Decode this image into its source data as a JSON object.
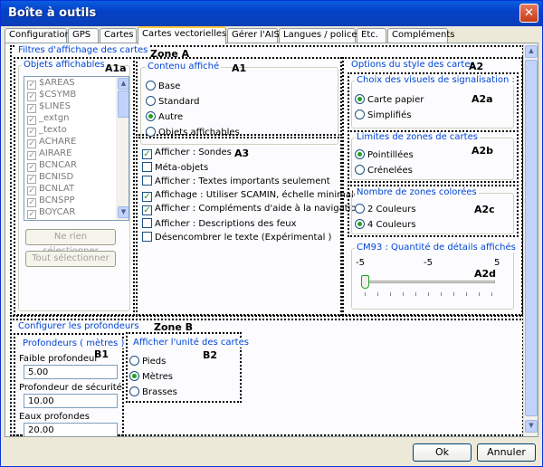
{
  "window": {
    "title": "Boîte à outils",
    "close": "✕"
  },
  "tabs": [
    "Configuration",
    "GPS",
    "Cartes",
    "Cartes vectorielles",
    "Gérer l'AIS",
    "Langues / polices",
    "Etc.",
    "Compléments"
  ],
  "active_tab": "Cartes vectorielles",
  "zone_a": {
    "legend": "Filtres d'affichage des cartes",
    "label": "Zone A",
    "objets": {
      "legend": "Objets affichables",
      "label": "A1a",
      "items": [
        "$AREAS",
        "$CSYMB",
        "$LINES",
        "_extgn",
        "_texto",
        "ACHARE",
        "AIRARE",
        "BCNCAR",
        "BCNISD",
        "BCNLAT",
        "BCNSPP",
        "BOYCAR"
      ],
      "btn_none": "Ne rien sélectionner",
      "btn_all": "Tout sélectionner"
    },
    "contenu": {
      "legend": "Contenu affiché",
      "label": "A1",
      "options": [
        "Base",
        "Standard",
        "Autre",
        "Objets affichables"
      ],
      "selected": "Autre"
    },
    "a3_label": "A3",
    "checks": [
      {
        "label": "Afficher : Sondes",
        "checked": true
      },
      {
        "label": "Méta-objets",
        "checked": false
      },
      {
        "label": "Afficher : Textes importants seulement",
        "checked": false
      },
      {
        "label": "Affichage : Utiliser SCAMIN, échelle minimale",
        "checked": true
      },
      {
        "label": "Afficher : Compléments d'aide à la navigation.",
        "checked": true
      },
      {
        "label": "Afficher : Descriptions des feux",
        "checked": false
      },
      {
        "label": "Désencombrer le texte (Expérimental )",
        "checked": false
      }
    ],
    "style": {
      "legend": "Options du style des cartes",
      "label": "A2",
      "visuels": {
        "legend": "Choix des visuels de signalisation :",
        "label": "A2a",
        "options": [
          "Carte papier",
          "Simplifiés"
        ],
        "selected": "Carte papier"
      },
      "limites": {
        "legend": "Limites de zones de cartes",
        "label": "A2b",
        "options": [
          "Pointillées",
          "Crénelées"
        ],
        "selected": "Pointillées"
      },
      "zones": {
        "legend": "Nombre de zones colorées",
        "label": "A2c",
        "options": [
          "2 Couleurs",
          "4 Couleurs"
        ],
        "selected": "4 Couleurs"
      },
      "cm93": {
        "legend": "CM93 : Quantité de détails affichés",
        "label": "A2d",
        "min": "-5",
        "mid": "-5",
        "max": "5",
        "value_fraction": 0.0
      }
    }
  },
  "zone_b": {
    "legend": "Configurer les profondeurs",
    "label": "Zone B",
    "profondeurs": {
      "legend": "Profondeurs ( mètres )",
      "label": "B1",
      "faible_label": "Faible profondeur",
      "faible_value": "5.00",
      "securite_label": "Profondeur de sécurité",
      "securite_value": "10.00",
      "eaux_label": "Eaux profondes",
      "eaux_value": "20.00"
    },
    "unites": {
      "legend": "Afficher l'unité des cartes",
      "label": "B2",
      "options": [
        "Pieds",
        "Mètres",
        "Brasses"
      ],
      "selected": "Mètres"
    }
  },
  "footer": {
    "ok": "Ok",
    "cancel": "Annuler"
  }
}
